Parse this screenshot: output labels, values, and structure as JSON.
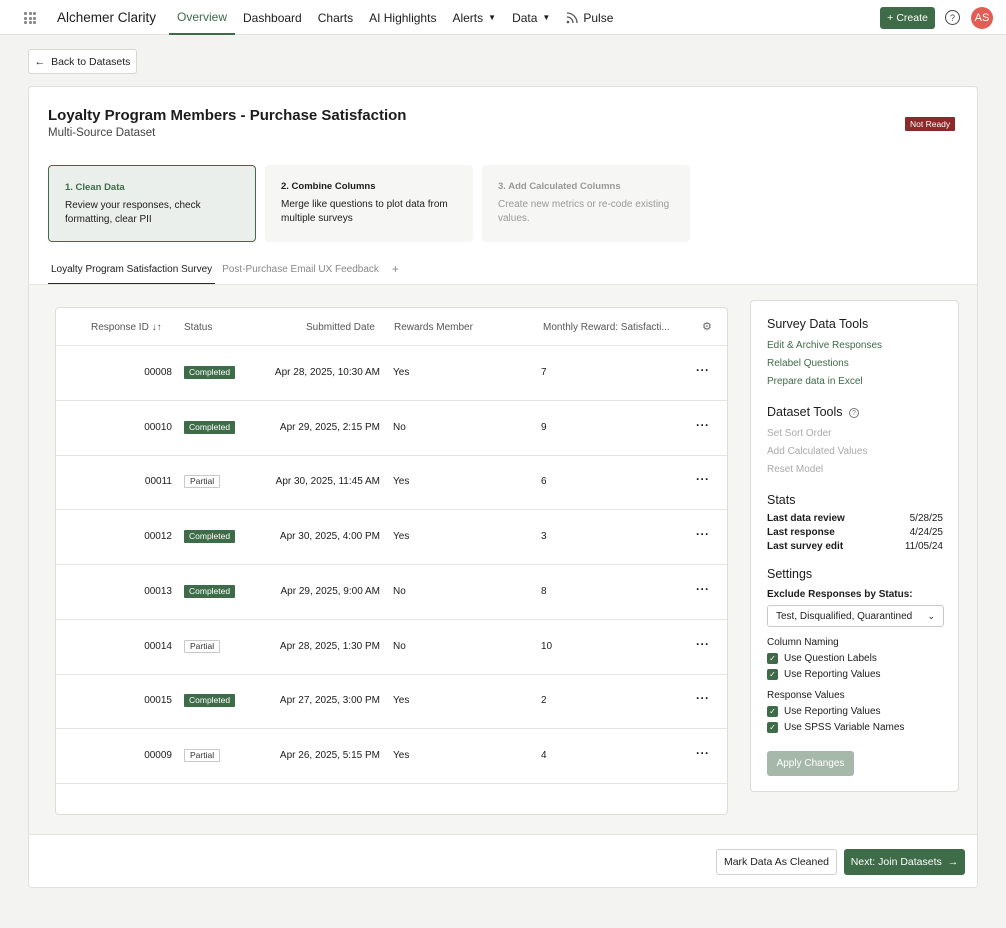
{
  "app": {
    "brand": "Alchemer Clarity"
  },
  "nav": {
    "items": [
      {
        "label": "Overview"
      },
      {
        "label": "Dashboard"
      },
      {
        "label": "Charts"
      },
      {
        "label": "AI Highlights"
      },
      {
        "label": "Alerts"
      },
      {
        "label": "Data"
      },
      {
        "label": "Pulse"
      }
    ],
    "create_label": "Create",
    "avatar": "AS",
    "help": "?"
  },
  "back_label": "Back to Datasets",
  "dataset": {
    "title": "Loyalty Program Members - Purchase Satisfaction",
    "subtitle": "Multi-Source Dataset",
    "status_badge": "Not Ready"
  },
  "steps": [
    {
      "title": "1. Clean Data",
      "desc": "Review your responses, check formatting, clear PII"
    },
    {
      "title": "2. Combine Columns",
      "desc": "Merge like questions to plot data from multiple surveys"
    },
    {
      "title": "3. Add Calculated Columns",
      "desc": "Create new metrics or re-code existing values."
    }
  ],
  "tabs": [
    {
      "label": "Loyalty Program Satisfaction Survey"
    },
    {
      "label": "Post-Purchase Email UX Feedback"
    }
  ],
  "tab_add": "+",
  "table": {
    "headers": [
      "Response ID",
      "Status",
      "Submitted Date",
      "Rewards Member",
      "Monthly Reward: Satisfacti..."
    ],
    "sort_icon": "↓↑",
    "rows": [
      {
        "id": "00008",
        "status": "Completed",
        "date": "Apr 28, 2025, 10:30 AM",
        "member": "Yes",
        "value": "7"
      },
      {
        "id": "00010",
        "status": "Completed",
        "date": "Apr 29, 2025, 2:15 PM",
        "member": "No",
        "value": "9"
      },
      {
        "id": "00011",
        "status": "Partial",
        "date": "Apr 30, 2025, 11:45 AM",
        "member": "Yes",
        "value": "6"
      },
      {
        "id": "00012",
        "status": "Completed",
        "date": "Apr 30, 2025, 4:00 PM",
        "member": "Yes",
        "value": "3"
      },
      {
        "id": "00013",
        "status": "Completed",
        "date": "Apr 29, 2025, 9:00 AM",
        "member": "No",
        "value": "8"
      },
      {
        "id": "00014",
        "status": "Partial",
        "date": "Apr 28, 2025, 1:30 PM",
        "member": "No",
        "value": "10"
      },
      {
        "id": "00015",
        "status": "Completed",
        "date": "Apr 27, 2025, 3:00 PM",
        "member": "Yes",
        "value": "2"
      },
      {
        "id": "00009",
        "status": "Partial",
        "date": "Apr 26, 2025, 5:15 PM",
        "member": "Yes",
        "value": "4"
      }
    ],
    "more": "···"
  },
  "panel": {
    "survey_tools_title": "Survey Data Tools",
    "survey_tools": [
      "Edit & Archive Responses",
      "Relabel Questions",
      "Prepare data in Excel"
    ],
    "dataset_tools_title": "Dataset Tools",
    "dataset_tools": [
      "Set Sort Order",
      "Add Calculated Values",
      "Reset Model"
    ],
    "stats_title": "Stats",
    "stats": [
      {
        "label": "Last data review",
        "value": "5/28/25"
      },
      {
        "label": "Last response",
        "value": "4/24/25"
      },
      {
        "label": "Last survey edit",
        "value": "11/05/24"
      }
    ],
    "settings_title": "Settings",
    "exclude_label": "Exclude Responses by Status:",
    "exclude_value": "Test, Disqualified, Quarantined",
    "column_naming_label": "Column Naming",
    "column_naming": [
      "Use Question Labels",
      "Use Reporting Values"
    ],
    "response_values_label": "Response Values",
    "response_values": [
      "Use Reporting Values",
      "Use SPSS Variable Names"
    ],
    "apply_label": "Apply Changes"
  },
  "footer": {
    "mark_label": "Mark Data As Cleaned",
    "next_label": "Next: Join Datasets"
  },
  "colors": {
    "accent": "#3e6b48",
    "danger": "#8a2a2a",
    "avatar": "#e35d55"
  }
}
